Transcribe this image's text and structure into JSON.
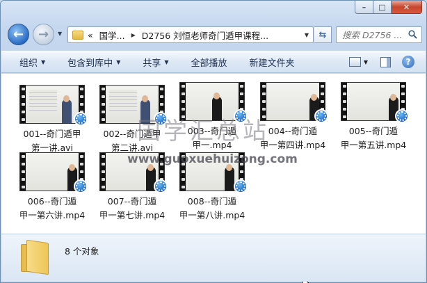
{
  "window": {
    "caption": {
      "minimize": "–",
      "maximize": "□",
      "close": "✕"
    }
  },
  "nav": {
    "back_icon": "←",
    "forward_icon": "→",
    "address_overflow": "«",
    "breadcrumb": [
      "国学...",
      "D2756 刘恒老师奇门遁甲课程..."
    ],
    "refresh_icon": "⇆",
    "search_placeholder": "搜索 D2756 ..."
  },
  "toolbar": {
    "organize": "组织",
    "include_in_library": "包含到库中",
    "share": "共享",
    "play_all": "全部播放",
    "new_folder": "新建文件夹",
    "help": "?"
  },
  "files": [
    {
      "line1": "001--奇门遁甲",
      "line2": "第一讲.avi",
      "thumb": "classroom"
    },
    {
      "line1": "002--奇门遁甲",
      "line2": "第二讲.avi",
      "thumb": "classroom"
    },
    {
      "line1": "003--奇门遁",
      "line2": "甲一.mp4",
      "thumb": "whiteboard"
    },
    {
      "line1": "004--奇门遁",
      "line2": "甲一第四讲.mp4",
      "thumb": "whiteboard"
    },
    {
      "line1": "005--奇门遁",
      "line2": "甲一第五讲.mp4",
      "thumb": "whiteboard"
    },
    {
      "line1": "006--奇门遁",
      "line2": "甲一第六讲.mp4",
      "thumb": "whiteboard"
    },
    {
      "line1": "007--奇门遁",
      "line2": "甲一第七讲.mp4",
      "thumb": "whiteboard"
    },
    {
      "line1": "008--奇门遁",
      "line2": "甲一第八讲.mp4",
      "thumb": "whiteboard"
    }
  ],
  "watermark": {
    "title": "国学汇总站",
    "url": "www.guoxuehuizong.com"
  },
  "details": {
    "count_text": "8 个对象"
  }
}
